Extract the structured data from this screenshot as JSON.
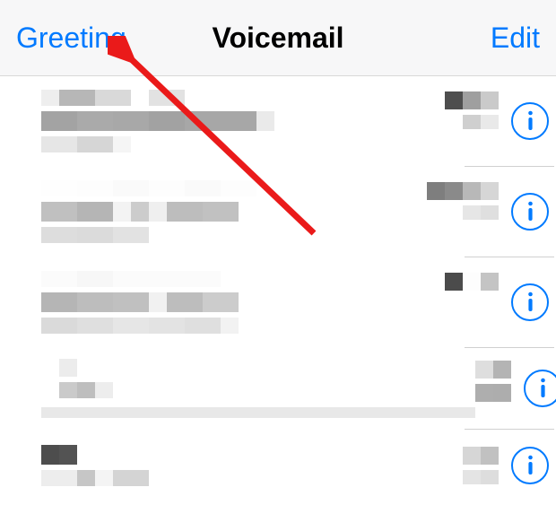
{
  "navbar": {
    "greeting_label": "Greeting",
    "title": "Voicemail",
    "edit_label": "Edit"
  },
  "colors": {
    "link": "#007aff",
    "text": "#000000",
    "annotation_arrow": "#ea1a1a"
  },
  "voicemails": [
    {
      "id": "vm1"
    },
    {
      "id": "vm2"
    },
    {
      "id": "vm3"
    },
    {
      "id": "vm4"
    },
    {
      "id": "vm5"
    }
  ]
}
